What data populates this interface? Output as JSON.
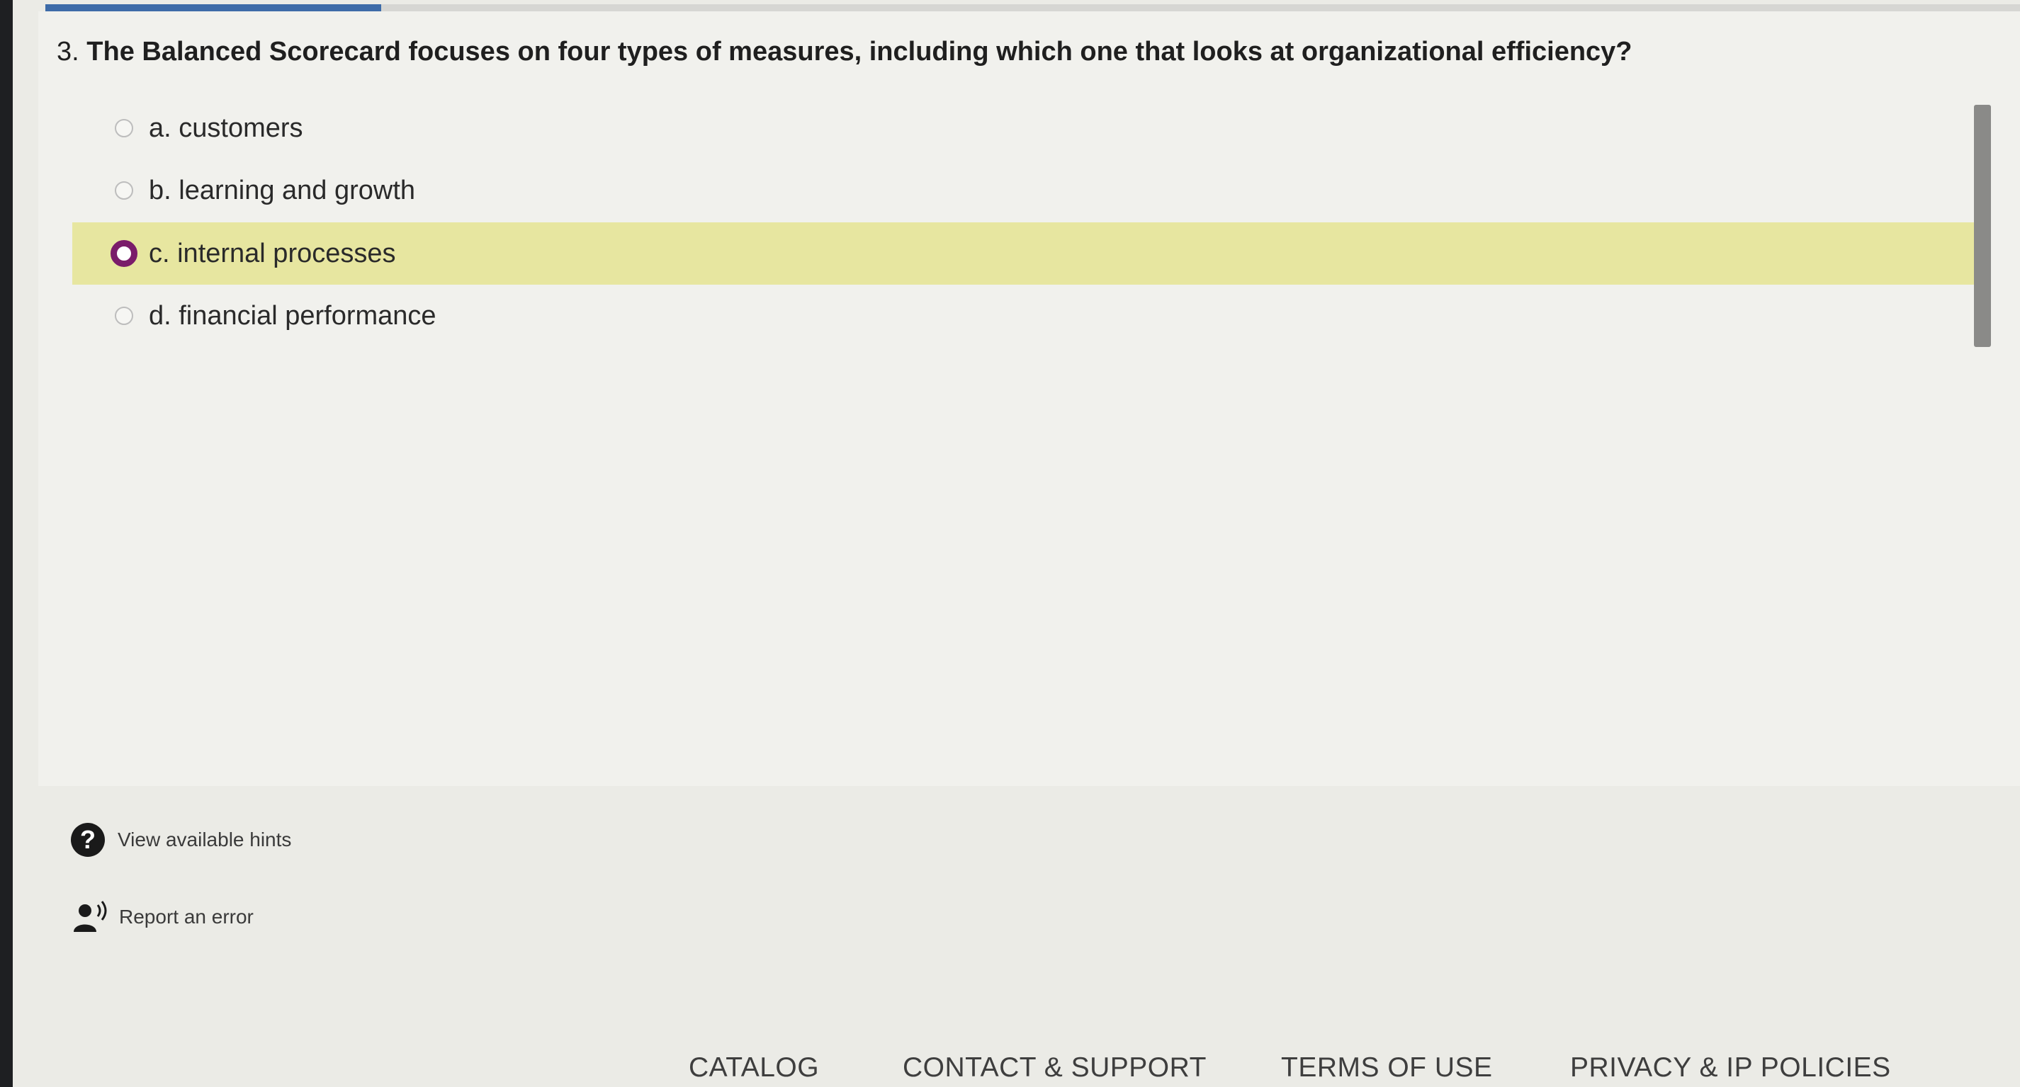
{
  "progress": {
    "fraction": 0.17
  },
  "question": {
    "number": "3.",
    "text": "The Balanced Scorecard focuses on four types of measures, including which one that looks at organizational efficiency?"
  },
  "options": [
    {
      "label": "a. customers",
      "selected": false
    },
    {
      "label": "b. learning and growth",
      "selected": false
    },
    {
      "label": "c. internal processes",
      "selected": true
    },
    {
      "label": "d. financial performance",
      "selected": false
    }
  ],
  "links": {
    "hints": {
      "label": "View available hints",
      "icon": "question-circle-icon"
    },
    "report": {
      "label": "Report an error",
      "icon": "person-speaking-icon"
    }
  },
  "footer": {
    "catalog": "CATALOG",
    "contact": "CONTACT & SUPPORT",
    "terms": "TERMS OF USE",
    "privacy": "PRIVACY & IP POLICIES"
  },
  "colors": {
    "accent": "#7a1c6a",
    "selected_highlight": "#e7e6a0",
    "progress": "#3d6ba8"
  }
}
